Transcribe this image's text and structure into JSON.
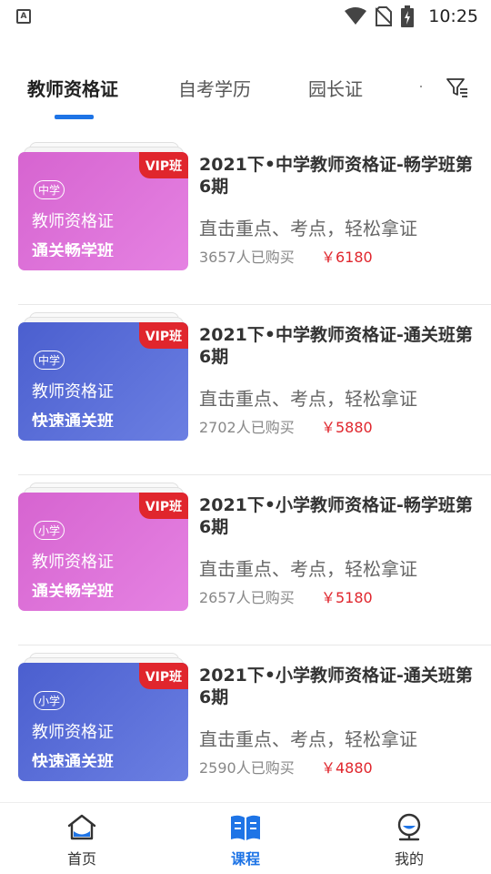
{
  "status_bar": {
    "app_indicator": "A",
    "time": "10:25",
    "icons": [
      "wifi-icon",
      "no-sim-icon",
      "battery-charging-icon"
    ]
  },
  "tabs": [
    {
      "label": "教师资格证",
      "active": true
    },
    {
      "label": "自考学历",
      "active": false
    },
    {
      "label": "园长证",
      "active": false
    }
  ],
  "courses": [
    {
      "title": "2021下•中学教师资格证-畅学班第6期",
      "description": "直击重点、考点，轻松拿证",
      "buyers": "3657人已购买",
      "price": "￥6180",
      "thumb": {
        "badge": "VIP班",
        "level": "中学",
        "cert": "教师资格证",
        "class_name": "通关畅学班",
        "theme": "pink"
      }
    },
    {
      "title": "2021下•中学教师资格证-通关班第6期",
      "description": "直击重点、考点，轻松拿证",
      "buyers": "2702人已购买",
      "price": "￥5880",
      "thumb": {
        "badge": "VIP班",
        "level": "中学",
        "cert": "教师资格证",
        "class_name": "快速通关班",
        "theme": "blue"
      }
    },
    {
      "title": "2021下•小学教师资格证-畅学班第6期",
      "description": "直击重点、考点，轻松拿证",
      "buyers": "2657人已购买",
      "price": "￥5180",
      "thumb": {
        "badge": "VIP班",
        "level": "小学",
        "cert": "教师资格证",
        "class_name": "通关畅学班",
        "theme": "pink"
      }
    },
    {
      "title": "2021下•小学教师资格证-通关班第6期",
      "description": "直击重点、考点，轻松拿证",
      "buyers": "2590人已购买",
      "price": "￥4880",
      "thumb": {
        "badge": "VIP班",
        "level": "小学",
        "cert": "教师资格证",
        "class_name": "快速通关班",
        "theme": "blue"
      }
    }
  ],
  "bottom_nav": [
    {
      "label": "首页",
      "icon": "home-icon",
      "active": false
    },
    {
      "label": "课程",
      "icon": "book-icon",
      "active": true
    },
    {
      "label": "我的",
      "icon": "profile-icon",
      "active": false
    }
  ],
  "colors": {
    "accent": "#1e74e6",
    "price": "#e0262d",
    "vip_badge": "#e0262d",
    "thumb_pink": "#de72da",
    "thumb_blue": "#5a6ed8"
  }
}
